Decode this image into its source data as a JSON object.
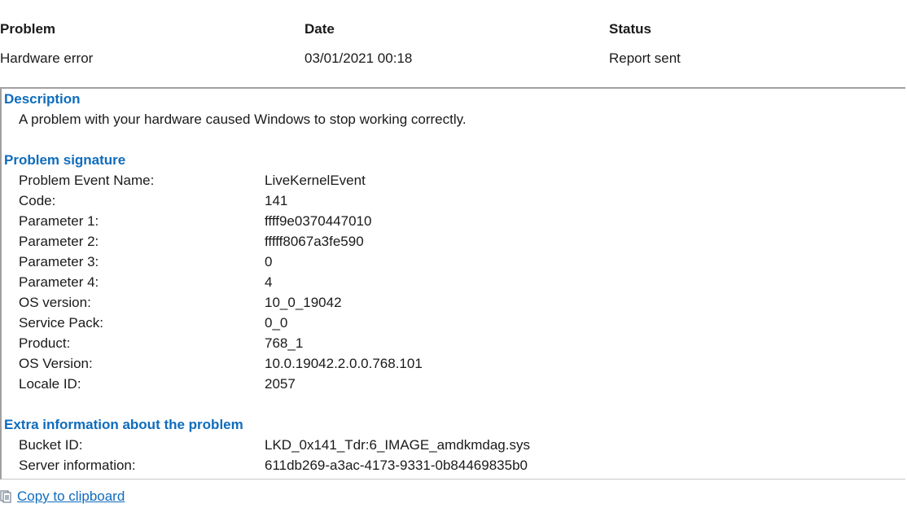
{
  "header": {
    "problem_label": "Problem",
    "date_label": "Date",
    "status_label": "Status"
  },
  "summary": {
    "problem": "Hardware error",
    "date": "03/01/2021 00:18",
    "status": "Report sent"
  },
  "description": {
    "title": "Description",
    "text": "A problem with your hardware caused Windows to stop working correctly."
  },
  "signature": {
    "title": "Problem signature",
    "rows": [
      {
        "label": "Problem Event Name:",
        "value": "LiveKernelEvent"
      },
      {
        "label": "Code:",
        "value": "141"
      },
      {
        "label": "Parameter 1:",
        "value": "ffff9e0370447010"
      },
      {
        "label": "Parameter 2:",
        "value": "fffff8067a3fe590"
      },
      {
        "label": "Parameter 3:",
        "value": "0"
      },
      {
        "label": "Parameter 4:",
        "value": "4"
      },
      {
        "label": "OS version:",
        "value": "10_0_19042"
      },
      {
        "label": "Service Pack:",
        "value": "0_0"
      },
      {
        "label": "Product:",
        "value": "768_1"
      },
      {
        "label": "OS Version:",
        "value": "10.0.19042.2.0.0.768.101"
      },
      {
        "label": "Locale ID:",
        "value": "2057"
      }
    ]
  },
  "extra": {
    "title": "Extra information about the problem",
    "rows": [
      {
        "label": "Bucket ID:",
        "value": "LKD_0x141_Tdr:6_IMAGE_amdkmdag.sys"
      },
      {
        "label": "Server information:",
        "value": "611db269-a3ac-4173-9331-0b84469835b0"
      }
    ]
  },
  "actions": {
    "copy_label": "Copy to clipboard",
    "copy_icon": "clipboard-icon"
  },
  "colors": {
    "link_blue": "#0f6cbd",
    "border_gray": "#a0a0a0"
  }
}
